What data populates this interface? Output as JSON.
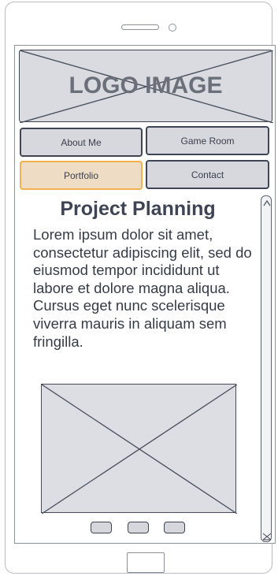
{
  "logo": {
    "text": "LOGO IMAGE"
  },
  "nav": {
    "about": "About Me",
    "game": "Game Room",
    "portfolio": "Portfolio",
    "contact": "Contact",
    "active": "Portfolio"
  },
  "content": {
    "title": "Project Planning",
    "paragraph": "Lorem ipsum dolor sit amet, consectetur adipiscing elit, sed do eiusmod tempor incididunt ut labore et dolore magna aliqua. Cursus eget nunc scelerisque viverra mauris in aliquam sem fringilla."
  },
  "carousel": {
    "dots": 3
  },
  "colors": {
    "accent": "#f2b04e",
    "active_fill": "#efdcc5",
    "placeholder_fill": "#d9dbe0",
    "outline": "#3d4350"
  }
}
